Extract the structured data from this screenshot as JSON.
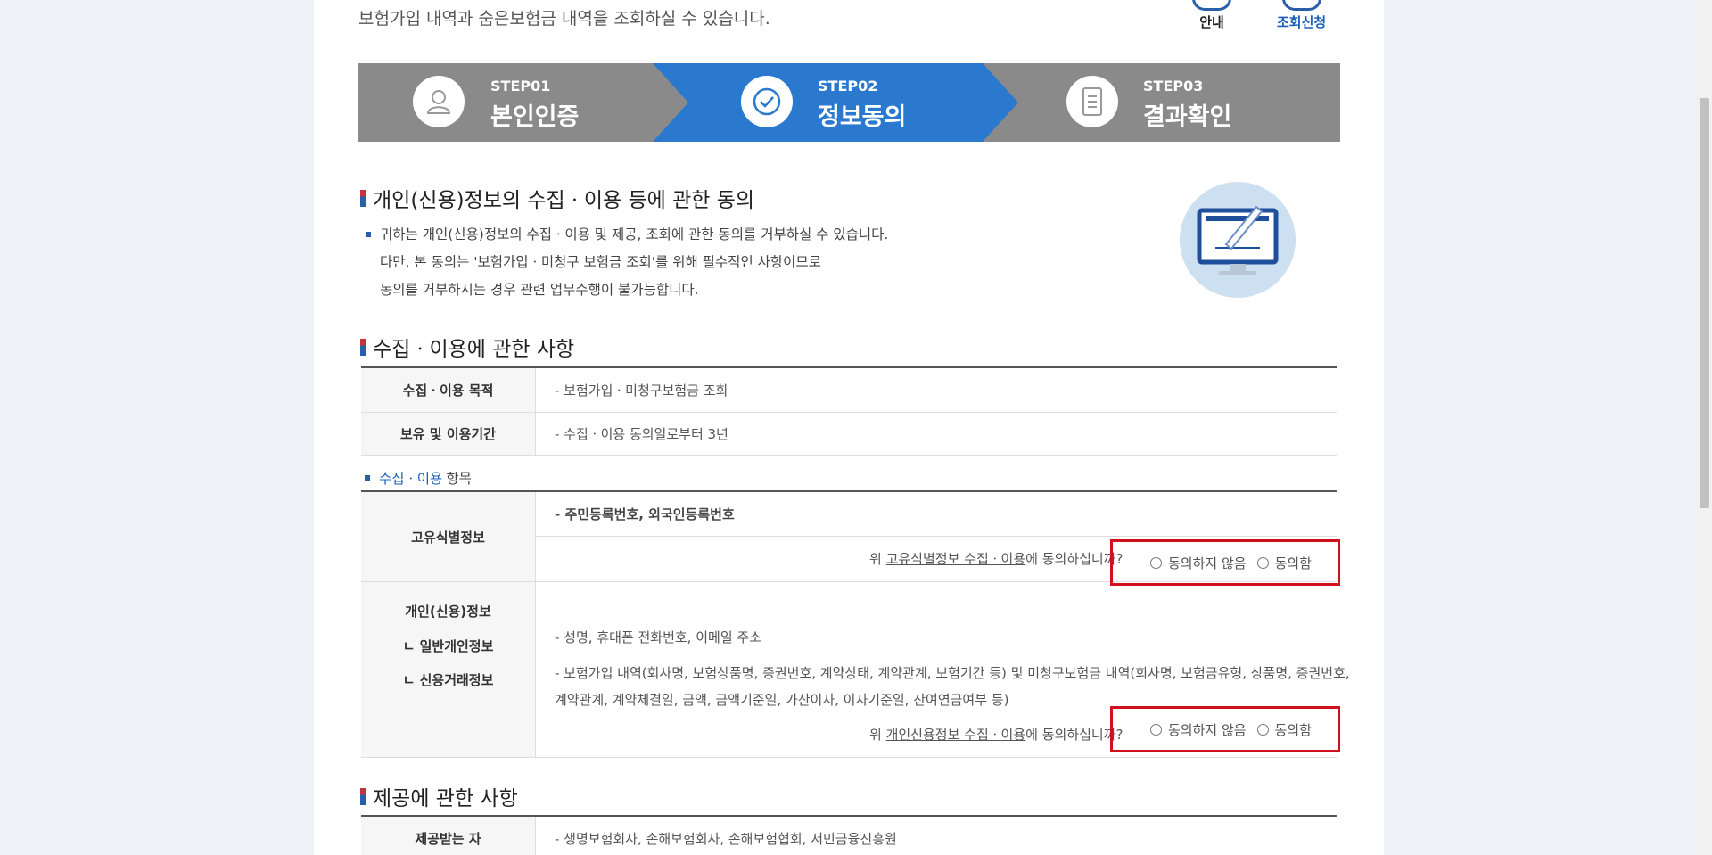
{
  "intro": "보험가입 내역과 숨은보험금 내역을 조회하실 수 있습니다.",
  "top_links": [
    {
      "label": "안내",
      "icon": "info-icon"
    },
    {
      "label": "조회신청",
      "icon": "apply-icon"
    }
  ],
  "steps": [
    {
      "num": "STEP01",
      "name": "본인인증",
      "icon": "person-icon",
      "active": false
    },
    {
      "num": "STEP02",
      "name": "정보동의",
      "icon": "check-circle-icon",
      "active": true
    },
    {
      "num": "STEP03",
      "name": "결과확인",
      "icon": "document-icon",
      "active": false
    }
  ],
  "section1": {
    "title": "개인(신용)정보의 수집ㆍ이용 등에 관한 동의",
    "lines": [
      "귀하는 개인(신용)정보의 수집ㆍ이용 및 제공, 조회에 관한 동의를 거부하실 수 있습니다.",
      "다만, 본 동의는 '보험가입ㆍ미청구 보험금 조회'를 위해 필수적인 사항이므로",
      "동의를 거부하시는 경우 관련 업무수행이 불가능합니다."
    ]
  },
  "section2": {
    "title": "수집ㆍ이용에 관한 사항",
    "rows": [
      {
        "label": "수집ㆍ이용 목적",
        "value": "- 보험가입ㆍ미청구보험금 조회"
      },
      {
        "label": "보유 및 이용기간",
        "value": "- 수집ㆍ이용 동의일로부터 3년"
      }
    ],
    "subhead_blue": "수집ㆍ이용",
    "subhead_rest": "항목",
    "unique": {
      "label": "고유식별정보",
      "value": "- 주민등록번호, 외국인등록번호",
      "q_pre": "위 ",
      "q_link": "고유식별정보 수집ㆍ이용",
      "q_post": "에 동의하십니까?"
    },
    "personal": {
      "label1": "개인(신용)정보",
      "label2": "ㄴ 일반개인정보",
      "label3": "ㄴ 신용거래정보",
      "value1": "- 성명, 휴대폰 전화번호, 이메일 주소",
      "value2a": "- 보험가입 내역(회사명, 보험상품명, 증권번호, 계약상태, 계약관계, 보험기간 등) 및 미청구보험금 내역(회사명, 보험금유형, 상품명, 증권번호,",
      "value2b": "계약관계, 계약체결일, 금액, 금액기준일, 가산이자, 이자기준일, 잔여연금여부 등)",
      "q_pre": "위 ",
      "q_link": "개인신용정보 수집ㆍ이용",
      "q_post": "에 동의하십니까?"
    },
    "disagree": "동의하지 않음",
    "agree": "동의함"
  },
  "section3": {
    "title": "제공에 관한 사항",
    "row_label": "제공받는 자",
    "row_value": "- 생명보험회사, 손해보험회사, 손해보험협회, 서민금융진흥원"
  },
  "colors": {
    "active_step": "#2a79cf",
    "inactive_step": "#8a8a8a",
    "highlight": "#d0101c"
  }
}
